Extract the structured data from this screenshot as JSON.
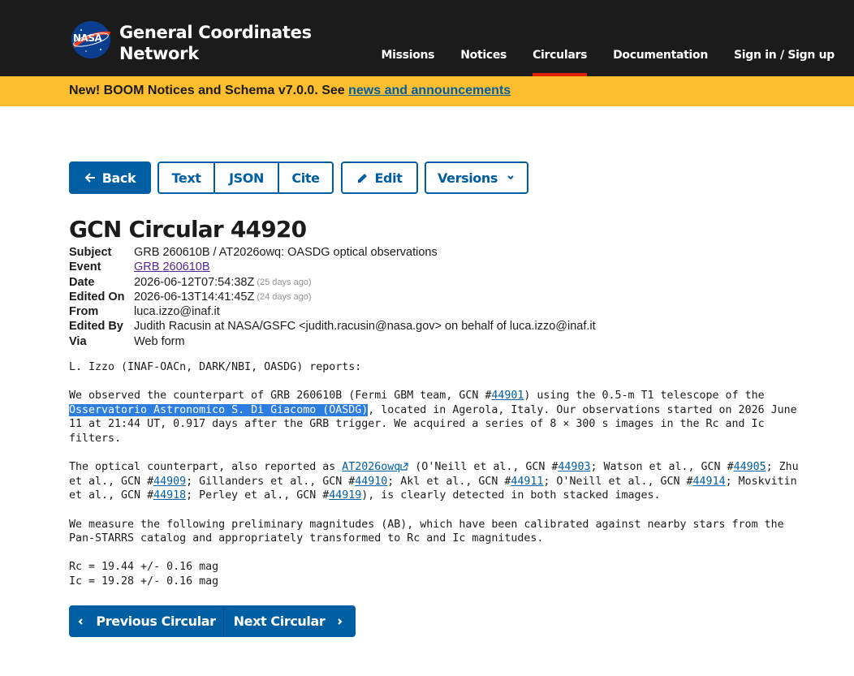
{
  "header": {
    "logo_icon": "nasa-meatball-logo",
    "logo_text": "NASA",
    "title_line1": "General Coordinates",
    "title_line2": "Network",
    "nav": [
      {
        "label": "Missions",
        "active": false
      },
      {
        "label": "Notices",
        "active": false
      },
      {
        "label": "Circulars",
        "active": true
      },
      {
        "label": "Documentation",
        "active": false
      },
      {
        "label": "Sign in / Sign up",
        "active": false
      }
    ]
  },
  "banner": {
    "text": "New! BOOM Notices and Schema v7.0.0. See ",
    "link": "news and announcements"
  },
  "toolbar": {
    "back": "Back",
    "text": "Text",
    "json": "JSON",
    "cite": "Cite",
    "edit": "Edit",
    "versions": "Versions"
  },
  "circular": {
    "title": "GCN Circular 44920",
    "meta": {
      "subject_label": "Subject",
      "subject": "GRB 260610B / AT2026owq: OASDG optical observations",
      "event_label": "Event",
      "event": "GRB 260610B",
      "date_label": "Date",
      "date": "2026-06-12T07:54:38Z",
      "date_ago": "(25 days ago)",
      "edited_on_label": "Edited On",
      "edited_on": "2026-06-13T14:41:45Z",
      "edited_ago": "(24 days ago)",
      "from_label": "From",
      "from": "luca.izzo@inaf.it",
      "edited_by_label": "Edited By",
      "edited_by": "Judith Racusin at NASA/GSFC <judith.racusin@nasa.gov> on behalf of luca.izzo@inaf.it",
      "via_label": "Via",
      "via": "Web form"
    },
    "body": {
      "p1": "L. Izzo (INAF-OACn, DARK/NBI, OASDG) reports:",
      "p2a": "We observed the counterpart of GRB 260610B (Fermi GBM team, GCN #",
      "p2_link": "44901",
      "p2b": ") using the 0.5-m T1 telescope of the\n",
      "p2_sel": "Osservatorio Astronomico S. Di Giacomo (OASDG)",
      "p2c": ", located in Agerola, Italy. Our observations started on 2026 June\n11 at 21:44 UT, 0.917 days after the GRB trigger. We acquired a series of 8 × 300 s images in the Rc and Ic\nfilters.",
      "p3a": "The optical counterpart, also reported as ",
      "p3_link_at": "AT2026owq",
      "p3b": " (O'Neill et al., GCN #",
      "p3_l1": "44903",
      "p3c": "; Watson et al., GCN #",
      "p3_l2": "44905",
      "p3d": "; Zhu\net al., GCN #",
      "p3_l3": "44909",
      "p3e": "; Gillanders et al., GCN #",
      "p3_l4": "44910",
      "p3f": "; Akl et al., GCN #",
      "p3_l5": "44911",
      "p3g": "; O'Neill et al., GCN #",
      "p3_l6": "44914",
      "p3h": "; Moskvitin\net al., GCN #",
      "p3_l7": "44918",
      "p3i": "; Perley et al., GCN #",
      "p3_l8": "44919",
      "p3j": "), is clearly detected in both stacked images.",
      "p4": "We measure the following preliminary magnitudes (AB), which have been calibrated against nearby stars from the\nPan-STARRS catalog and appropriately transformed to Rc and Ic magnitudes.",
      "p5": "Rc = 19.44 +/- 0.16 mag\nIc = 19.28 +/- 0.16 mag"
    }
  },
  "pager": {
    "prev": "Previous Circular",
    "next": "Next Circular"
  },
  "colors": {
    "header_bg": "#1b1b1b",
    "banner_bg": "#ffbe2e",
    "primary": "#005ea2",
    "active_nav": "#e52207"
  }
}
